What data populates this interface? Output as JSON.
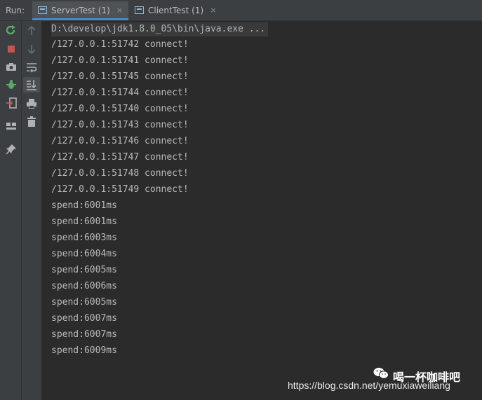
{
  "run_label": "Run:",
  "tabs": [
    {
      "label": "ServerTest (1)",
      "close": "×"
    },
    {
      "label": "ClientTest (1)",
      "close": "×"
    }
  ],
  "command": "D:\\develop\\jdk1.8.0_05\\bin\\java.exe ...",
  "lines": [
    "/127.0.0.1:51742 connect!",
    "/127.0.0.1:51741 connect!",
    "/127.0.0.1:51745 connect!",
    "/127.0.0.1:51744 connect!",
    "/127.0.0.1:51740 connect!",
    "/127.0.0.1:51743 connect!",
    "/127.0.0.1:51746 connect!",
    "/127.0.0.1:51747 connect!",
    "/127.0.0.1:51748 connect!",
    "/127.0.0.1:51749 connect!",
    "spend:6001ms",
    "spend:6001ms",
    "spend:6003ms",
    "spend:6004ms",
    "spend:6005ms",
    "spend:6006ms",
    "spend:6005ms",
    "spend:6007ms",
    "spend:6007ms",
    "spend:6009ms"
  ],
  "watermark": {
    "brand": "喝一杯咖啡吧",
    "url": "https://blog.csdn.net/yemuxiaweiliang"
  },
  "icons": {
    "rerun": "rerun-icon",
    "stop": "stop-icon",
    "camera": "camera-icon",
    "debug": "debug-icon",
    "exit": "exit-icon",
    "layout": "layout-icon",
    "pin": "pin-icon",
    "up": "up-arrow-icon",
    "down": "down-arrow-icon",
    "wrap": "soft-wrap-icon",
    "scroll_end": "scroll-to-end-icon",
    "print": "print-icon",
    "trash": "trash-icon"
  }
}
